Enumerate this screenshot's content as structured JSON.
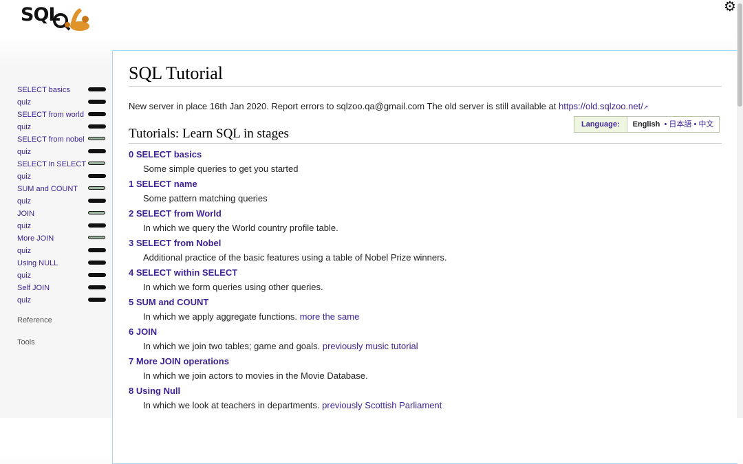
{
  "logo": {
    "text": "SQL"
  },
  "sidebar": {
    "items": [
      {
        "label": "SELECT basics",
        "progress": 1
      },
      {
        "label": "quiz",
        "progress": 1
      },
      {
        "label": "SELECT from world",
        "progress": 1
      },
      {
        "label": "quiz",
        "progress": 1
      },
      {
        "label": "SELECT from nobel",
        "progress": 0.5
      },
      {
        "label": "quiz",
        "progress": 1
      },
      {
        "label": "SELECT in SELECT",
        "progress": 0.5
      },
      {
        "label": "quiz",
        "progress": 1
      },
      {
        "label": "SUM and COUNT",
        "progress": 0.5
      },
      {
        "label": "quiz",
        "progress": 1
      },
      {
        "label": "JOIN",
        "progress": 0.5
      },
      {
        "label": "quiz",
        "progress": 1
      },
      {
        "label": "More JOIN",
        "progress": 0.5
      },
      {
        "label": "quiz",
        "progress": 1
      },
      {
        "label": "Using NULL",
        "progress": 1
      },
      {
        "label": "quiz",
        "progress": 1
      },
      {
        "label": "Self JOIN",
        "progress": 1
      },
      {
        "label": "quiz",
        "progress": 1
      }
    ],
    "reference": "Reference",
    "tools": "Tools"
  },
  "page": {
    "title": "SQL Tutorial",
    "notice": "New server in place 16th Jan 2020. Report errors to sqlzoo.qa@gmail.com The old server is still available at ",
    "notice_link": "https://old.sqlzoo.net/",
    "language_label": "Language:",
    "language_current": "English",
    "language_ja": "日本語",
    "language_zh": "中文",
    "subtitle": "Tutorials: Learn SQL in stages"
  },
  "tutorials": [
    {
      "title": "0 SELECT basics",
      "desc": "Some simple queries to get you started",
      "extra": ""
    },
    {
      "title": "1 SELECT name",
      "desc": "Some pattern matching queries",
      "extra": ""
    },
    {
      "title": "2 SELECT from World",
      "desc": "In which we query the World country profile table.",
      "extra": ""
    },
    {
      "title": "3 SELECT from Nobel",
      "desc": "Additional practice of the basic features using a table of Nobel Prize winners.",
      "extra": ""
    },
    {
      "title": "4 SELECT within SELECT",
      "desc": "In which we form queries using other queries.",
      "extra": ""
    },
    {
      "title": "5 SUM and COUNT",
      "desc": "In which we apply aggregate functions. ",
      "extra": "more the same"
    },
    {
      "title": "6 JOIN",
      "desc": "In which we join two tables; game and goals. ",
      "extra": "previously music tutorial"
    },
    {
      "title": "7 More JOIN operations",
      "desc": "In which we join actors to movies in the Movie Database.",
      "extra": ""
    },
    {
      "title": "8 Using Null",
      "desc": "In which we look at teachers in departments. ",
      "extra": "previously Scottish Parliament"
    }
  ]
}
